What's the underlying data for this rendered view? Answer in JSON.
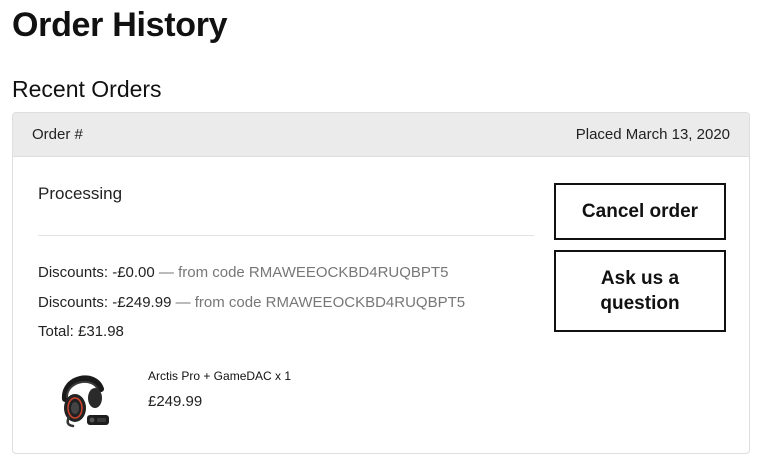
{
  "page": {
    "title": "Order History",
    "section_title": "Recent Orders"
  },
  "order": {
    "header": {
      "order_label": "Order #",
      "placed_label": "Placed March 13, 2020"
    },
    "status": "Processing",
    "discounts": [
      {
        "label": "Discounts: -£0.00",
        "source": "— from code RMAWEEOCKBD4RUQBPT5"
      },
      {
        "label": "Discounts: -£249.99",
        "source": "— from code RMAWEEOCKBD4RUQBPT5"
      }
    ],
    "total": "Total: £31.98",
    "items": [
      {
        "name": "Arctis Pro + GameDAC x 1",
        "price": "£249.99",
        "image_icon": "headset-icon"
      }
    ],
    "actions": {
      "cancel_label": "Cancel order",
      "ask_label": "Ask us a question"
    }
  },
  "colors": {
    "header_bg": "#ebebeb",
    "border": "#dedede",
    "muted_text": "#777777",
    "headset_accent": "#d2452f"
  }
}
